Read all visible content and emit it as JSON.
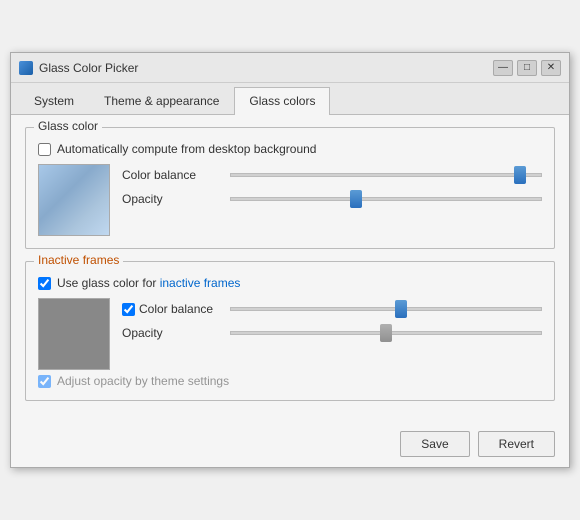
{
  "window": {
    "title": "Glass Color Picker"
  },
  "tabs": [
    {
      "id": "system",
      "label": "System"
    },
    {
      "id": "theme",
      "label": "Theme & appearance"
    },
    {
      "id": "glass",
      "label": "Glass colors",
      "active": true
    }
  ],
  "glass_color_group": {
    "title": "Glass color",
    "auto_checkbox": {
      "checked": false,
      "label": "Automatically compute from desktop background"
    },
    "color_balance_label": "Color balance",
    "opacity_label": "Opacity",
    "slider_color_balance_value": 95,
    "slider_opacity_value": 40
  },
  "inactive_frames_group": {
    "title": "Inactive frames",
    "use_glass_checkbox": {
      "checked": true,
      "label": "Use glass color for inactive frames"
    },
    "color_balance_label": "Color balance",
    "opacity_label": "Opacity",
    "partial_label": "Adjust opacity by theme settings",
    "slider_color_balance_value": 55,
    "slider_opacity_value": 50
  },
  "footer": {
    "save_label": "Save",
    "revert_label": "Revert"
  },
  "title_controls": {
    "minimize": "—",
    "maximize": "□",
    "close": "✕"
  }
}
